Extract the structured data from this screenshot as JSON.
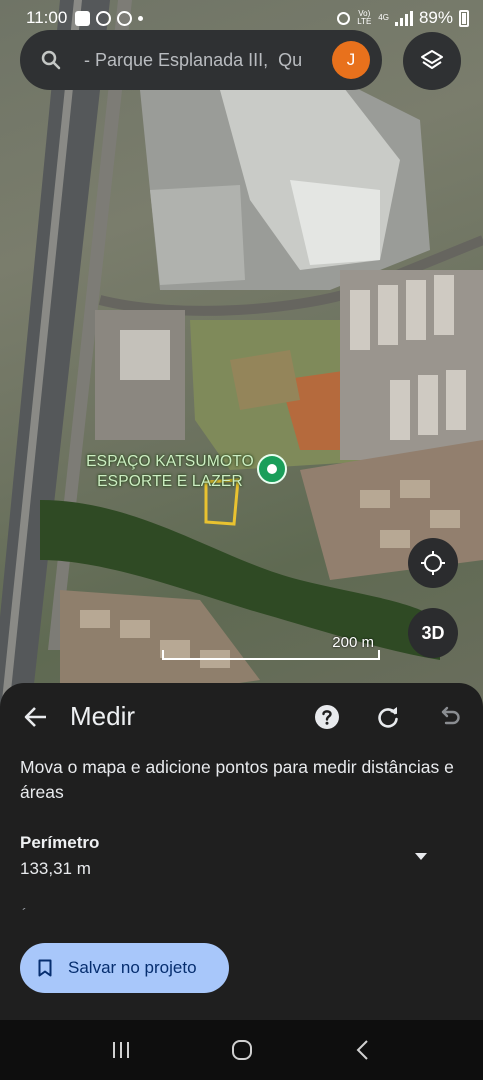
{
  "status_bar": {
    "time": "11:00",
    "network": "4G",
    "volte": "Vo) LTE",
    "battery": "89%"
  },
  "search": {
    "query": "- Parque Esplanada III,  Qu",
    "avatar_letter": "J"
  },
  "map": {
    "place_label_line1": "ESPAÇO KATSUMOTO",
    "place_label_line2": "ESPORTE E LAZER",
    "scale_label": "200 m",
    "button_3d": "3D",
    "pin_color": "#1a9e5a",
    "measure_outline_color": "#e9c230"
  },
  "sheet": {
    "title": "Medir",
    "description": "Mova o mapa e adicione pontos para medir distâncias e áreas",
    "perimeter_label": "Perímetro",
    "perimeter_value": "133,31 m",
    "save_label": "Salvar no projeto",
    "icons": [
      "back-arrow-icon",
      "help-icon",
      "redo-icon",
      "undo-icon",
      "chevron-down-icon",
      "bookmark-icon"
    ]
  },
  "colors": {
    "sheet_bg": "#1f1f1f",
    "save_button_bg": "#a8c7fa",
    "avatar_bg": "#e8711c"
  }
}
